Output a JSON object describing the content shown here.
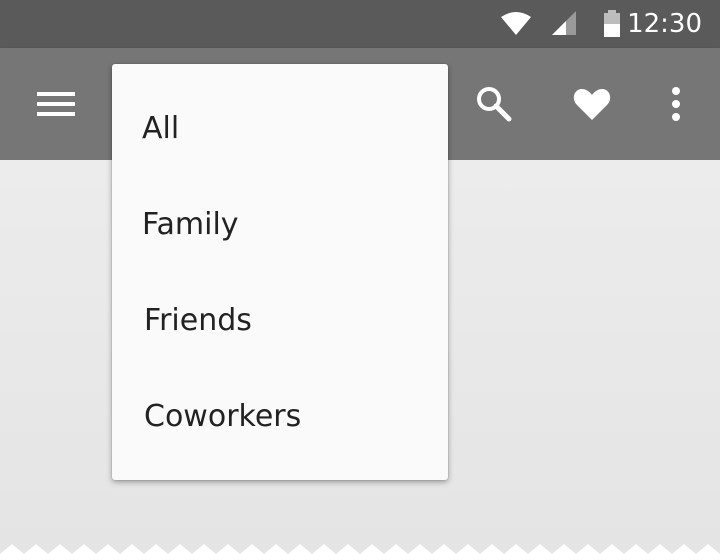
{
  "status_bar": {
    "time": "12:30",
    "icons": [
      "wifi-icon",
      "cell-signal-icon",
      "battery-icon"
    ]
  },
  "app_bar": {
    "icons": [
      "menu-icon",
      "search-icon",
      "heart-icon",
      "more-vert-icon"
    ]
  },
  "menu": {
    "items": [
      {
        "label": "All"
      },
      {
        "label": "Family"
      },
      {
        "label": "Friends"
      },
      {
        "label": "Coworkers"
      }
    ]
  },
  "colors": {
    "status_bar": "#5a5a5a",
    "app_bar": "#767676",
    "background": "#e6e6e6",
    "menu_surface": "#fafafa",
    "menu_text": "#222222",
    "icon": "#ffffff"
  }
}
